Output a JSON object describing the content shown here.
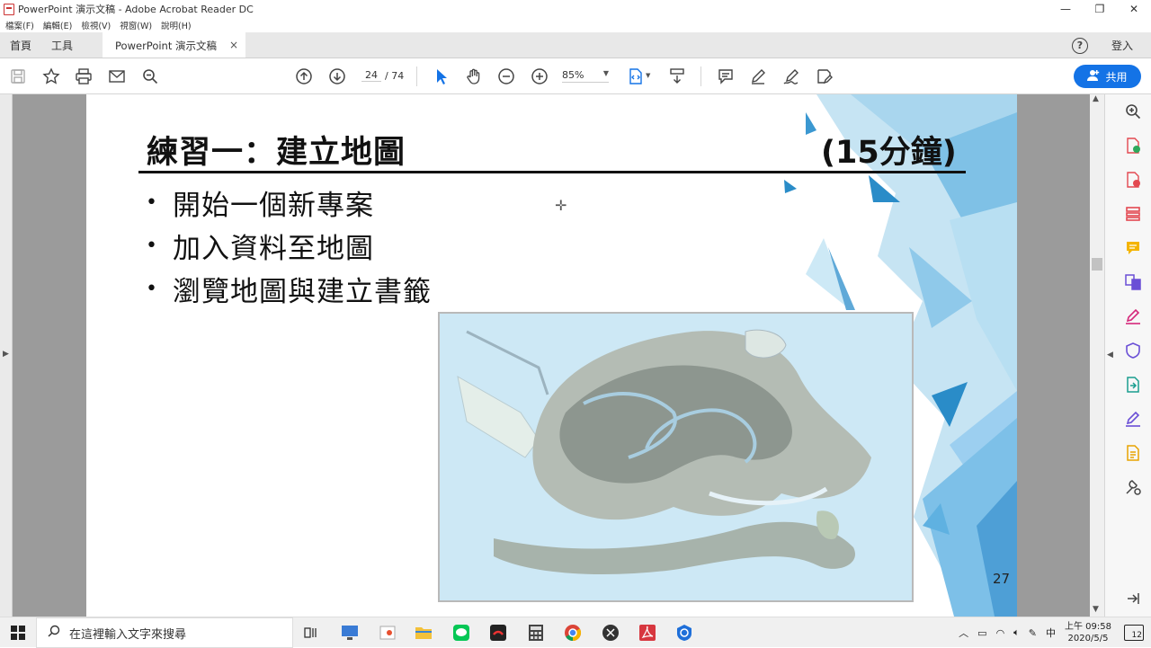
{
  "window": {
    "title": "PowerPoint 演示文稿 - Adobe Acrobat Reader DC",
    "controls": [
      "—",
      "❐",
      "✕"
    ]
  },
  "menu": [
    "檔案(F)",
    "編輯(E)",
    "檢視(V)",
    "視窗(W)",
    "說明(H)"
  ],
  "tabs": {
    "home": "首頁",
    "tools": "工具",
    "document": "PowerPoint 演示文稿",
    "close": "×",
    "help": "?",
    "signin": "登入"
  },
  "toolbar": {
    "current_page": "24",
    "total_pages": "/ 74",
    "zoom": "85%",
    "share_label": "共用"
  },
  "slide": {
    "title": "練習一：建立地圖",
    "time": "(15分鐘)",
    "bullets": [
      "開始一個新專案",
      "加入資料至地圖",
      "瀏覽地圖與建立書籤"
    ],
    "page_number": "27"
  },
  "taskbar": {
    "search_placeholder": "在這裡輸入文字來搜尋",
    "time": "上午 09:58",
    "date": "2020/5/5",
    "ime": "中",
    "notifications": "12"
  },
  "colors": {
    "accent": "#1473e6",
    "acrobat_red": "#d7373f",
    "workarea": "#9b9b9b"
  }
}
